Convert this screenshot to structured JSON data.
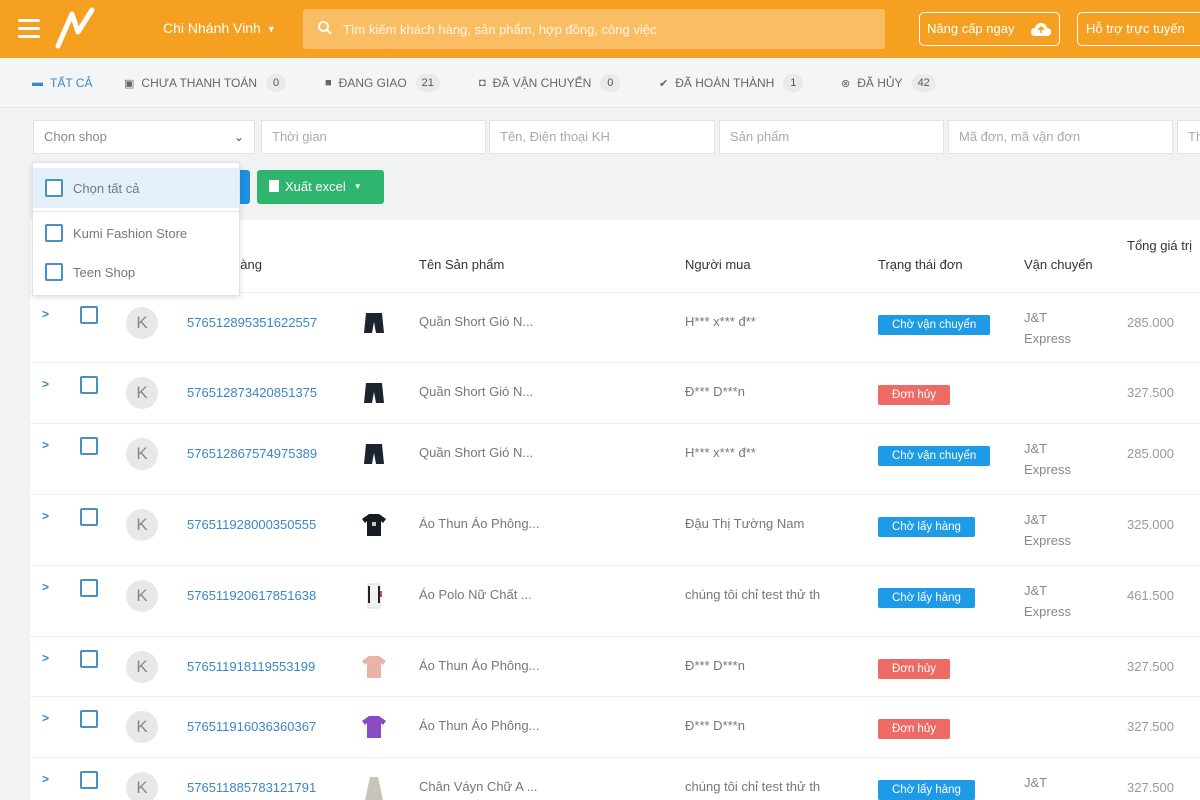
{
  "header": {
    "branch": "Chi Nhánh Vinh",
    "search_placeholder": "Tìm kiếm khách hàng, sản phẩm, hợp đồng, công việc",
    "upgrade_label": "Nâng cấp ngay",
    "support_label": "Hỗ trợ trực tuyến",
    "accent_color": "#f6a021"
  },
  "tabs": [
    {
      "label": "TẤT CẢ",
      "icon": "list-icon",
      "count": null
    },
    {
      "label": "CHƯA THANH TOÁN",
      "icon": "card-icon",
      "count": "0"
    },
    {
      "label": "ĐANG GIAO",
      "icon": "truck-icon",
      "count": "21"
    },
    {
      "label": "ĐÃ VẬN CHUYỂN",
      "icon": "box-icon",
      "count": "0"
    },
    {
      "label": "ĐÃ HOÀN THÀNH",
      "icon": "check-icon",
      "count": "1"
    },
    {
      "label": "ĐÃ HỦY",
      "icon": "cancel-icon",
      "count": "42"
    }
  ],
  "filters": {
    "shop": "Chọn shop",
    "time": "Thời gian",
    "customer": "Tên, Điện thoại KH",
    "product": "Sản phẩm",
    "order_code": "Mã đơn, mã vận đơn",
    "extra": "Th"
  },
  "actions": {
    "excel_label": "Xuất excel"
  },
  "shop_dropdown": {
    "select_all": "Chọn tất cả",
    "options": [
      "Kumi Fashion Store",
      "Teen Shop"
    ]
  },
  "table": {
    "headers": {
      "order": "hàng",
      "product": "Tên Sản phẩm",
      "buyer": "Người mua",
      "status": "Trạng thái đơn",
      "shipping": "Vận chuyển",
      "total": "Tổng giá trị"
    },
    "rows": [
      {
        "avatar": "K",
        "order_id": "576512895351622557",
        "product": "Quần Short Gió N...",
        "buyer": "H*** x*** đ**",
        "status": "Chờ vận chuyển",
        "status_color": "blue",
        "shipping": "J&T Express",
        "total": "285.000",
        "thumb": "shorts"
      },
      {
        "avatar": "K",
        "order_id": "576512873420851375",
        "product": "Quần Short Gió N...",
        "buyer": "Đ*** D***n",
        "status": "Đơn hủy",
        "status_color": "red",
        "shipping": "",
        "total": "327.500",
        "thumb": "shorts"
      },
      {
        "avatar": "K",
        "order_id": "576512867574975389",
        "product": "Quần Short Gió N...",
        "buyer": "H*** x*** đ**",
        "status": "Chờ vận chuyển",
        "status_color": "blue",
        "shipping": "J&T Express",
        "total": "285.000",
        "thumb": "shorts"
      },
      {
        "avatar": "K",
        "order_id": "576511928000350555",
        "product": "Áo Thun Áo Phông...",
        "buyer": "Đậu Thị Tường Nam",
        "status": "Chờ lấy hàng",
        "status_color": "blue",
        "shipping": "J&T Express",
        "total": "325.000",
        "thumb": "tshirt-black"
      },
      {
        "avatar": "K",
        "order_id": "576511920617851638",
        "product": "Áo Polo Nữ Chất ...",
        "buyer": "chúng tôi chỉ test thử th",
        "status": "Chờ lấy hàng",
        "status_color": "blue",
        "shipping": "J&T Express",
        "total": "461.500",
        "thumb": "polo"
      },
      {
        "avatar": "K",
        "order_id": "576511918119553199",
        "product": "Áo Thun Áo Phông...",
        "buyer": "Đ*** D***n",
        "status": "Đơn hủy",
        "status_color": "red",
        "shipping": "",
        "total": "327.500",
        "thumb": "tshirt-pink"
      },
      {
        "avatar": "K",
        "order_id": "576511916036360367",
        "product": "Áo Thun Áo Phông...",
        "buyer": "Đ*** D***n",
        "status": "Đơn hủy",
        "status_color": "red",
        "shipping": "",
        "total": "327.500",
        "thumb": "tshirt-purple"
      },
      {
        "avatar": "K",
        "order_id": "576511885783121791",
        "product": "Chân Váyn Chữ A ...",
        "buyer": "chúng tôi chỉ test thử th",
        "status": "Chờ lấy hàng",
        "status_color": "blue",
        "shipping": "J&T",
        "total": "327.500",
        "thumb": "skirt"
      }
    ]
  }
}
